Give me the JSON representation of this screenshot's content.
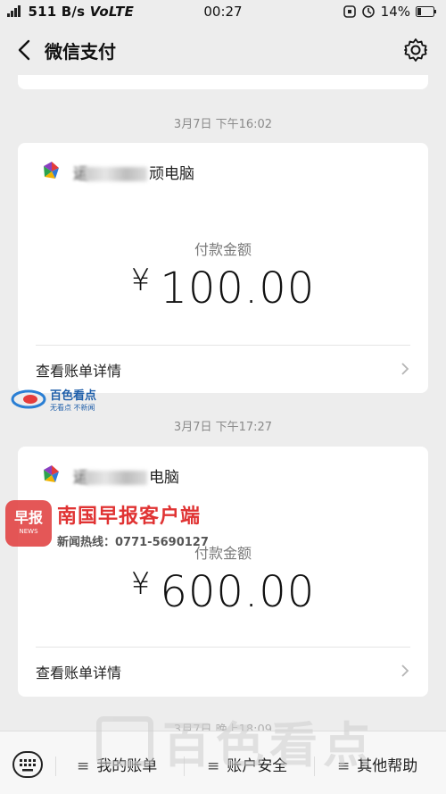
{
  "status_bar": {
    "network": "511 B/s",
    "volte": "VoLTE",
    "time": "00:27",
    "battery": "14%"
  },
  "header": {
    "title": "微信支付"
  },
  "transactions": [
    {
      "time": "3月7日  下午16:02",
      "merchant_start": "运",
      "merchant_end": "顽电脑",
      "pay_label": "付款金额",
      "currency": "¥",
      "amount": "100.00",
      "detail_label": "查看账单详情"
    },
    {
      "time": "3月7日  下午17:27",
      "merchant_start": "运",
      "merchant_end": "电脑",
      "pay_label": "付款金额",
      "currency": "¥",
      "amount": "600.00",
      "detail_label": "查看账单详情"
    }
  ],
  "next_time": "3月7日 晚上18:09",
  "watermarks": {
    "baise_main": "百色看点",
    "baise_sub": "无看点  不新闻",
    "nanguo_box": "早报",
    "nanguo_box_sub": "NEWS",
    "nanguo_title": "南国早报客户端",
    "nanguo_hotline": "新闻热线：0771-5690127",
    "footer_mark": "百色看点"
  },
  "bottom_menu": [
    {
      "label": "我的账单"
    },
    {
      "label": "账户安全"
    },
    {
      "label": "其他帮助"
    }
  ],
  "colors": {
    "background": "#ededed",
    "card": "#ffffff",
    "time_text": "#8a8a8a"
  }
}
